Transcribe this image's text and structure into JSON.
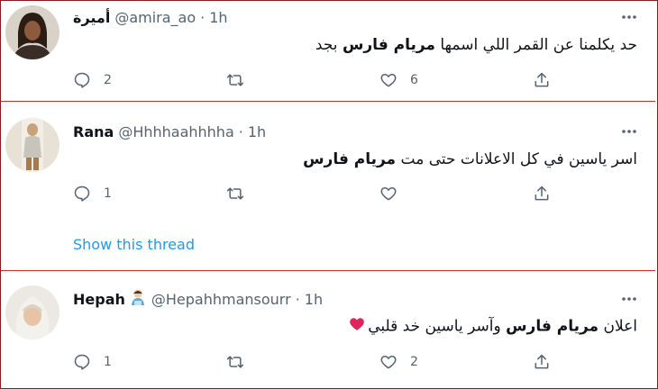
{
  "tweets": [
    {
      "name": "أميرة",
      "handle": "@amira_ao",
      "dot": "·",
      "time": "1h",
      "text_before": "حد يكلمنا عن القمر اللي اسمها ",
      "text_bold": "مريام فارس",
      "text_after": " بجد",
      "reply_count": "2",
      "like_count": "6"
    },
    {
      "name": "Rana",
      "handle": "@Hhhhaahhhha",
      "dot": "·",
      "time": "1h",
      "text_before": "اسر ياسين في كل الاعلانات حتى مت ",
      "text_bold": "مريام فارس",
      "text_after": "",
      "reply_count": "1",
      "like_count": "",
      "show_thread": "Show this thread"
    },
    {
      "name": "Hepah",
      "handle": "@Hepahhmansourr",
      "dot": "·",
      "time": "1h",
      "text_before": "اعلان ",
      "text_bold": "مريام فارس",
      "text_after": " وآسر ياسين خد قلبي",
      "reply_count": "1",
      "like_count": "2"
    }
  ],
  "colors": {
    "link": "#1d9bf0",
    "muted": "#536471",
    "divider": "#c9302c",
    "heart": "#e0245e"
  },
  "icons": [
    "reply-icon",
    "retweet-icon",
    "like-icon",
    "share-icon",
    "more-icon",
    "heart-emoji",
    "person-emoji"
  ]
}
